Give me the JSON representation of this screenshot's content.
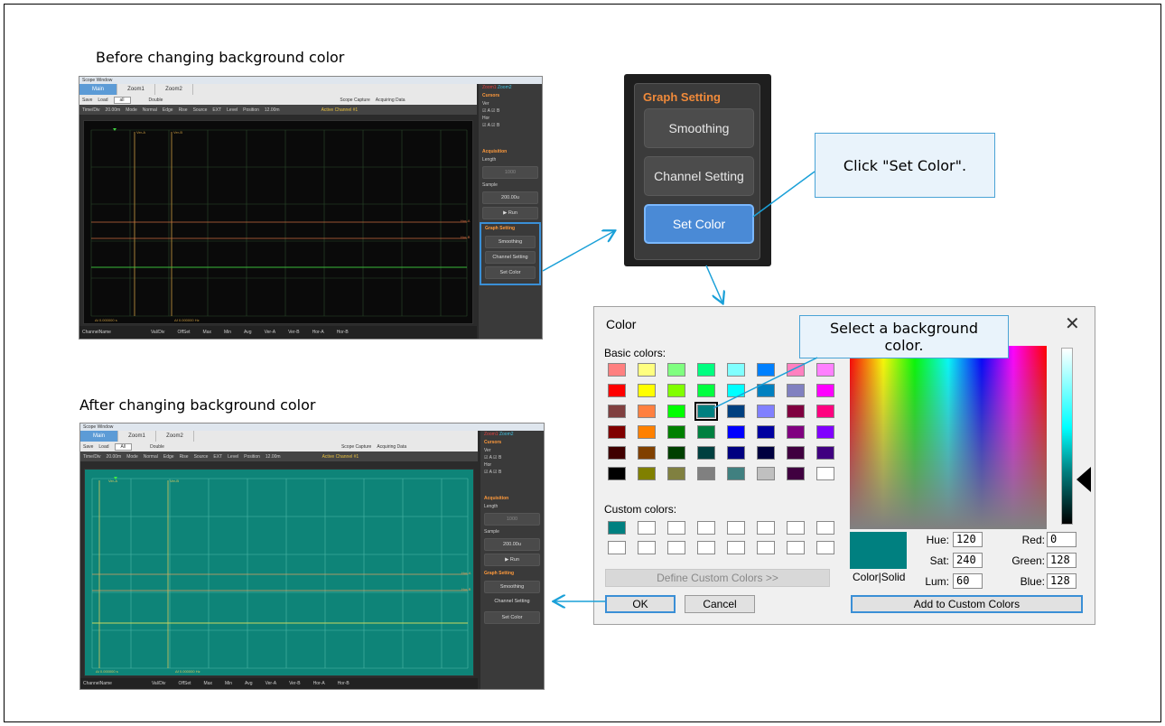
{
  "captions": {
    "before": "Before changing background color",
    "after": "After changing background color"
  },
  "scope": {
    "window_title": "Scope Window",
    "tabs": [
      "Main",
      "Zoom1",
      "Zoom2"
    ],
    "save": "Save",
    "load": "Load",
    "load_value_before": "all",
    "load_value_after": "All",
    "double": "Double",
    "scope_capture": "Scope Capture",
    "acquiring": "Acquiring Data",
    "timediv_label": "Time/Div",
    "timediv_value": "20.00m",
    "mode_label": "Mode",
    "mode_value": "Normal",
    "edge_label": "Edge",
    "edge_value": "Rise",
    "source_label": "Source",
    "source_value": "EXT",
    "level_label": "Level",
    "position_label": "Position",
    "position_value": "12.00m",
    "active_channel": "Active Channel #1",
    "marker_ver_a": "Ver-A",
    "marker_ver_b": "Ver-B",
    "marker_hor_a": "Hor-A",
    "marker_hor_b": "Hor-B",
    "delta_t": "Δt 0.000000 s",
    "delta_f": "Δf 0.000000 Hz",
    "status_cols": [
      "ChannelName",
      "Val/Div",
      "OffSet",
      "Max",
      "Min",
      "Avg",
      "Ver-A",
      "Ver-B",
      "Hor-A",
      "Hor-B"
    ],
    "side": {
      "zoom1": "Zoom1",
      "zoom2": "Zoom2",
      "cursors": "Cursors",
      "ver": "Ver",
      "hor": "Hor",
      "a": "A",
      "b": "B",
      "acquisition": "Acquisition",
      "length": "Length",
      "length_value": "1000",
      "sample": "Sample",
      "sample_value": "200.00u",
      "run": "▶ Run",
      "graph_setting": "Graph Setting",
      "smoothing": "Smoothing",
      "channel_setting": "Channel Setting",
      "set_color": "Set Color"
    }
  },
  "graph_setting_zoom": {
    "title": "Graph Setting",
    "smoothing": "Smoothing",
    "channel_setting": "Channel Setting",
    "set_color": "Set Color"
  },
  "callouts": {
    "click_set_color": "Click \"Set Color\".",
    "select_bg": "Select a background color."
  },
  "color_dialog": {
    "title": "Color",
    "close": "✕",
    "basic_colors": "Basic colors:",
    "custom_colors": "Custom colors:",
    "define_custom": "Define Custom Colors >>",
    "ok": "OK",
    "cancel": "Cancel",
    "color_solid": "Color|Solid",
    "add_custom": "Add to Custom Colors",
    "hue_label": "Hue:",
    "hue": "120",
    "sat_label": "Sat:",
    "sat": "240",
    "lum_label": "Lum:",
    "lum": "60",
    "red_label": "Red:",
    "red": "0",
    "green_label": "Green:",
    "green": "128",
    "blue_label": "Blue:",
    "blue": "128",
    "basic_swatches": [
      "#ff8080",
      "#ffff80",
      "#80ff80",
      "#00ff80",
      "#80ffff",
      "#0080ff",
      "#ff80c0",
      "#ff80ff",
      "#ff0000",
      "#ffff00",
      "#80ff00",
      "#00ff40",
      "#00ffff",
      "#0080c0",
      "#8080c0",
      "#ff00ff",
      "#804040",
      "#ff8040",
      "#00ff00",
      "#008080",
      "#004080",
      "#8080ff",
      "#800040",
      "#ff0080",
      "#800000",
      "#ff8000",
      "#008000",
      "#008040",
      "#0000ff",
      "#0000a0",
      "#800080",
      "#8000ff",
      "#400000",
      "#804000",
      "#004000",
      "#004040",
      "#000080",
      "#000040",
      "#400040",
      "#400080",
      "#000000",
      "#808000",
      "#808040",
      "#808080",
      "#408080",
      "#c0c0c0",
      "#400040",
      "#ffffff"
    ],
    "custom_swatches": [
      "#008080",
      "#ffffff",
      "#ffffff",
      "#ffffff",
      "#ffffff",
      "#ffffff",
      "#ffffff",
      "#ffffff",
      "#ffffff",
      "#ffffff",
      "#ffffff",
      "#ffffff",
      "#ffffff",
      "#ffffff",
      "#ffffff",
      "#ffffff"
    ],
    "selected_color": "#008080"
  },
  "colors": {
    "plot_before": "#0a0a0a",
    "plot_after": "#0e8478",
    "accent_blue": "#3a8fd6",
    "panel_orange": "#f08a3a"
  }
}
